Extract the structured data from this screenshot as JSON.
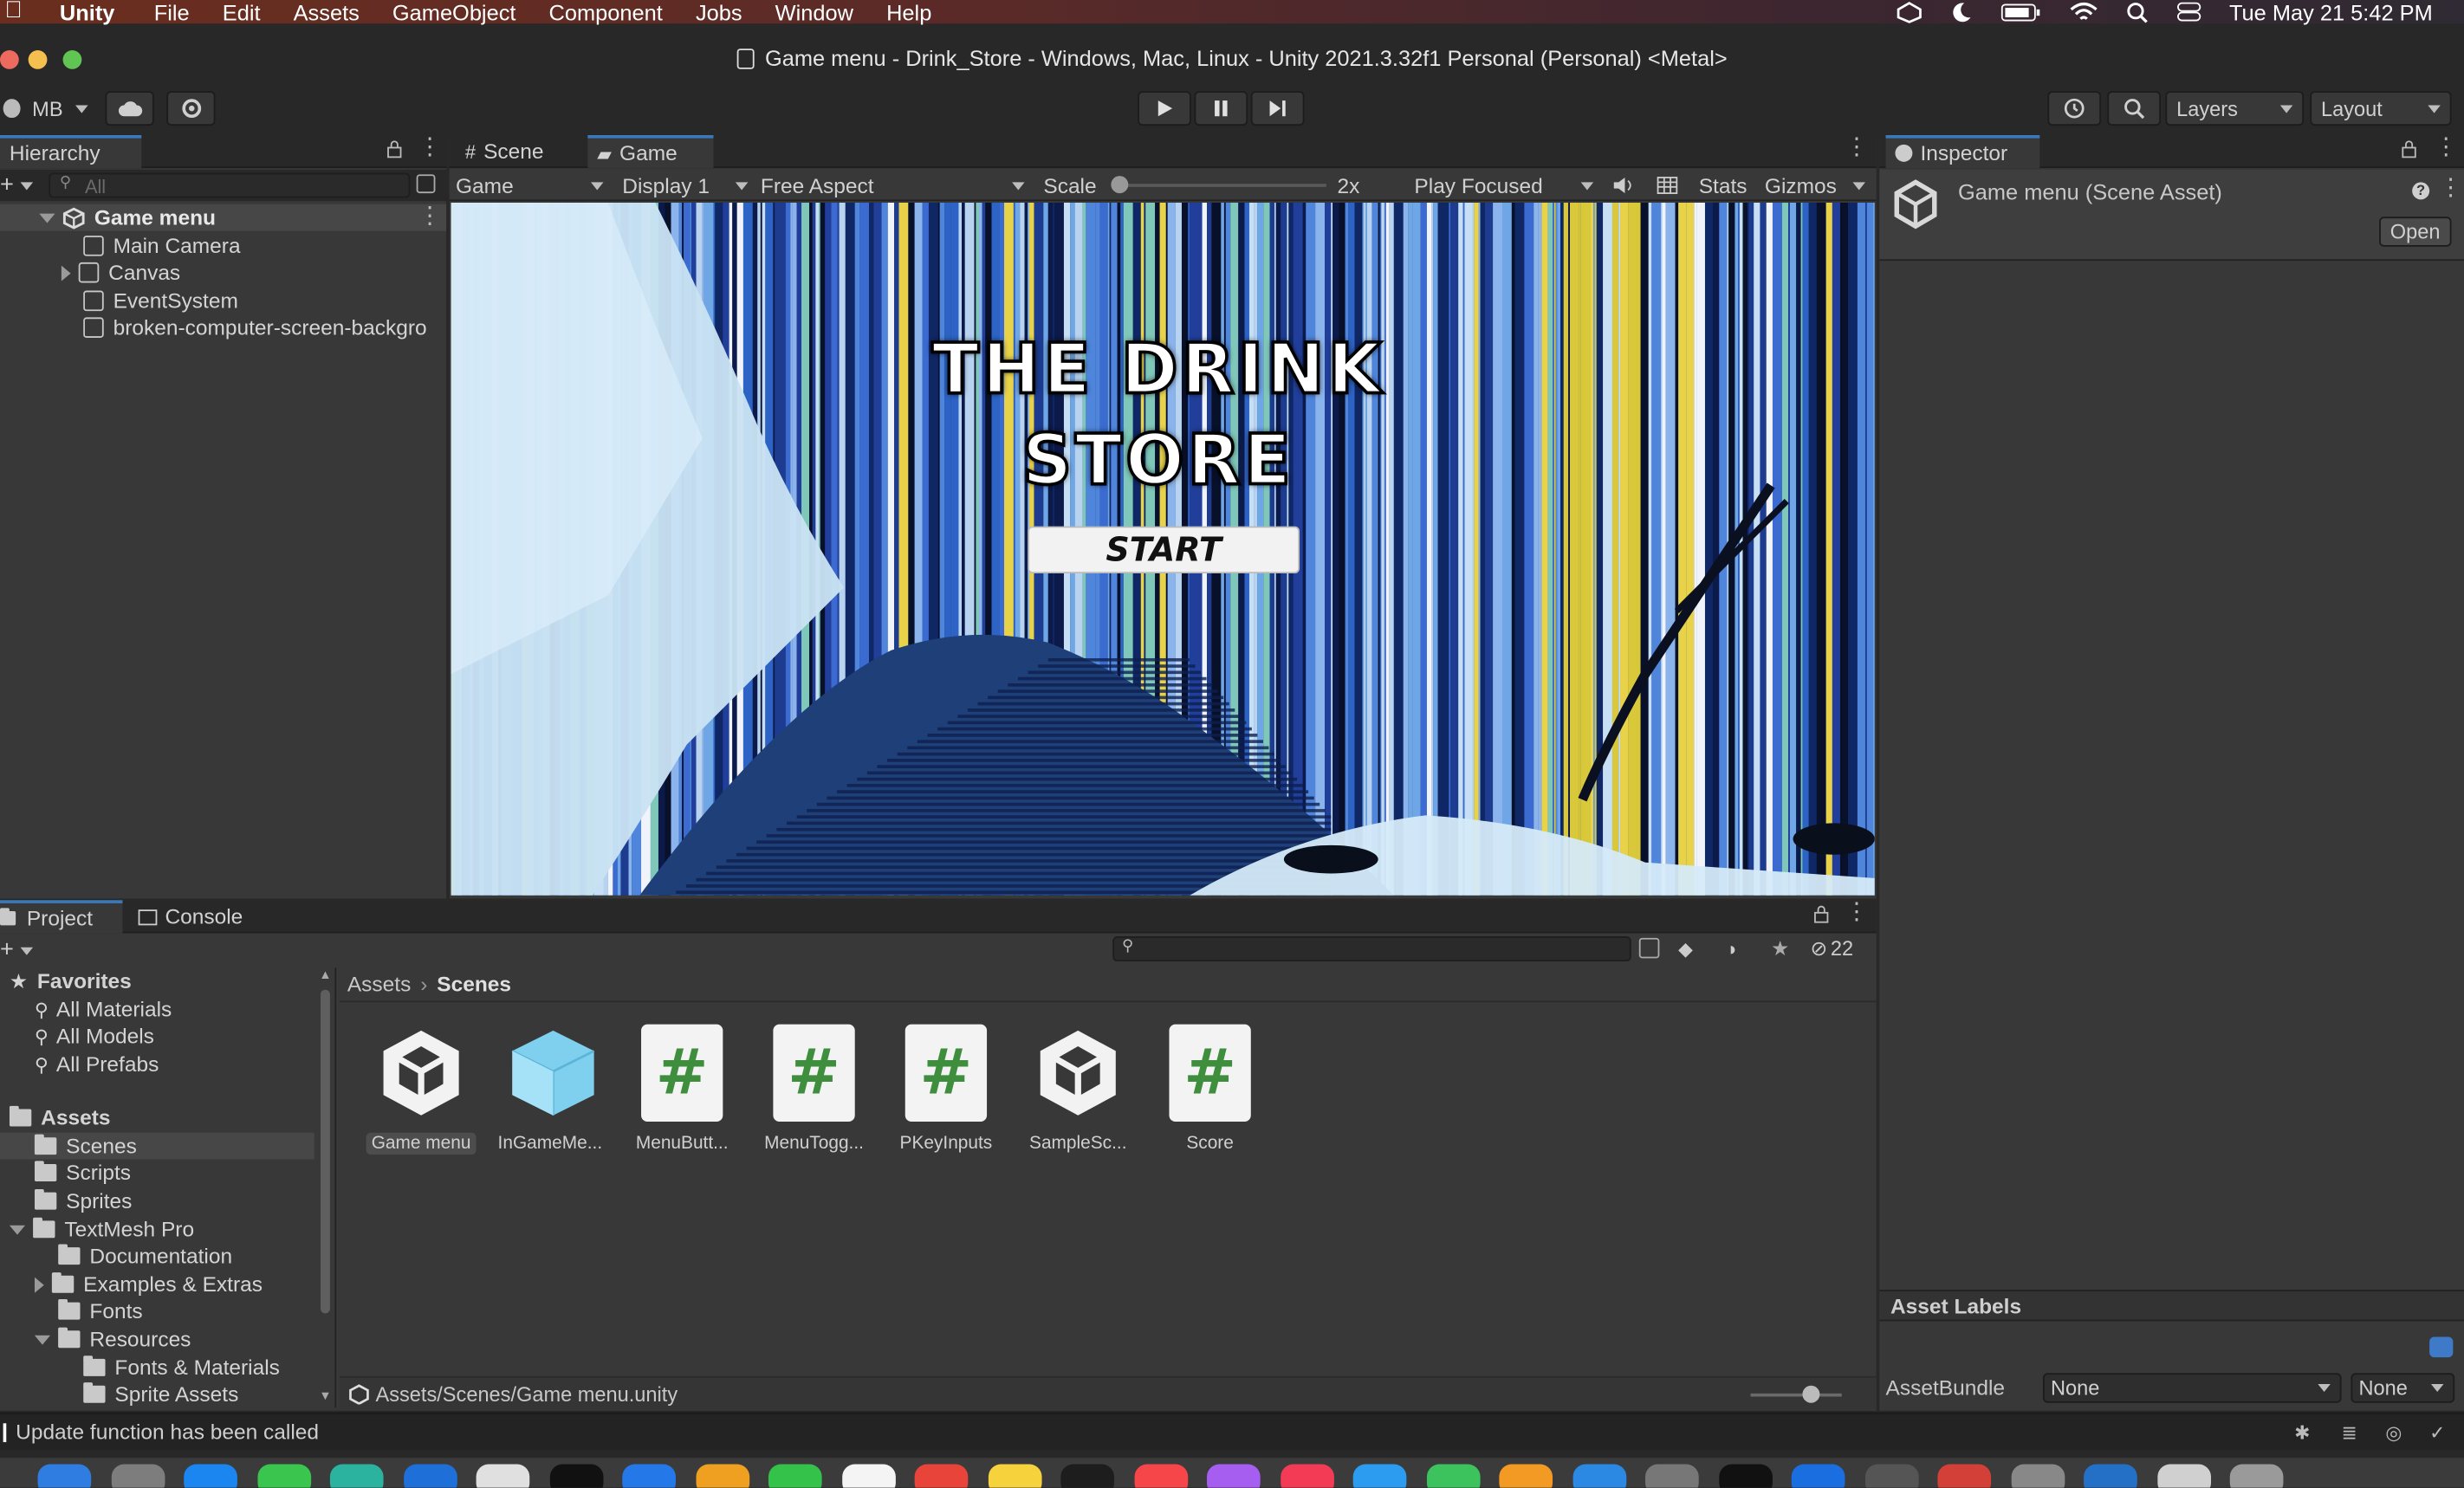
{
  "menubar": {
    "app": "Unity",
    "items": [
      "File",
      "Edit",
      "Assets",
      "GameObject",
      "Component",
      "Jobs",
      "Window",
      "Help"
    ],
    "clock": "Tue May 21  5:42 PM"
  },
  "window": {
    "title": "Game menu - Drink_Store - Windows, Mac, Linux - Unity 2021.3.32f1 Personal (Personal) <Metal>"
  },
  "toolbar": {
    "account": "MB",
    "layers": "Layers",
    "layout": "Layout"
  },
  "hierarchy": {
    "tab": "Hierarchy",
    "search_placeholder": "All",
    "scene": "Game menu",
    "items": [
      "Main Camera",
      "Canvas",
      "EventSystem",
      "broken-computer-screen-backgro"
    ]
  },
  "scene_tabs": {
    "scene": "Scene",
    "game": "Game"
  },
  "game_toolbar": {
    "mode": "Game",
    "display": "Display 1",
    "aspect": "Free Aspect",
    "scale_label": "Scale",
    "scale_value": "2x",
    "scale_fraction": 0.0,
    "play_mode": "Play Focused",
    "stats": "Stats",
    "gizmos": "Gizmos"
  },
  "game_view": {
    "title_line1": "THE DRINK",
    "title_line2": "STORE",
    "start_button": "START"
  },
  "inspector": {
    "tab": "Inspector",
    "asset_title": "Game menu (Scene Asset)",
    "open_button": "Open",
    "asset_labels": "Asset Labels",
    "assetbundle_label": "AssetBundle",
    "assetbundle_value": "None",
    "variant_value": "None"
  },
  "project": {
    "tab_project": "Project",
    "tab_console": "Console",
    "hidden_count": "22",
    "breadcrumb": [
      "Assets",
      "Scenes"
    ],
    "favorites_label": "Favorites",
    "favorites": [
      "All Materials",
      "All Models",
      "All Prefabs"
    ],
    "assets_label": "Assets",
    "tree": [
      {
        "label": "Scenes",
        "depth": 1,
        "selected": true
      },
      {
        "label": "Scripts",
        "depth": 1
      },
      {
        "label": "Sprites",
        "depth": 1
      },
      {
        "label": "TextMesh Pro",
        "depth": 1,
        "expanded": true
      },
      {
        "label": "Documentation",
        "depth": 2
      },
      {
        "label": "Examples & Extras",
        "depth": 2,
        "collapsed": true
      },
      {
        "label": "Fonts",
        "depth": 2
      },
      {
        "label": "Resources",
        "depth": 2,
        "expanded": true
      },
      {
        "label": "Fonts & Materials",
        "depth": 3
      },
      {
        "label": "Sprite Assets",
        "depth": 3
      }
    ],
    "assets": [
      {
        "label": "Game menu",
        "kind": "unity-scene-icon"
      },
      {
        "label": "InGameMe...",
        "kind": "prefab-cube-icon"
      },
      {
        "label": "MenuButt...",
        "kind": "script-icon"
      },
      {
        "label": "MenuTogg...",
        "kind": "script-icon"
      },
      {
        "label": "PKeyInputs",
        "kind": "script-icon"
      },
      {
        "label": "SampleSc...",
        "kind": "unity-scene-icon"
      },
      {
        "label": "Score",
        "kind": "script-icon"
      }
    ],
    "path": "Assets/Scenes/Game menu.unity"
  },
  "status_bar": {
    "message": "Update function has been called"
  },
  "colors": {
    "accent": "#3a79bb",
    "panel": "#383838",
    "dark": "#282828"
  }
}
